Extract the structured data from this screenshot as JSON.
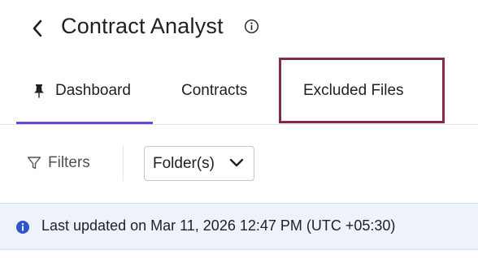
{
  "header": {
    "back_icon": "chevron-left-icon",
    "title": "Contract Analyst",
    "info_icon": "info-circle-icon"
  },
  "tabs": [
    {
      "label": "Dashboard",
      "icon": "pin-icon",
      "active": true
    },
    {
      "label": "Contracts",
      "active": false
    },
    {
      "label": "Excluded Files",
      "active": false,
      "highlighted": true
    }
  ],
  "toolbar": {
    "filters_label": "Filters",
    "filter_icon": "filter-funnel-icon",
    "folder_select_value": "Folder(s)",
    "folder_select_icon": "chevron-down-icon"
  },
  "banner": {
    "icon": "info-filled-icon",
    "text": "Last updated on Mar 11, 2026 12:47 PM (UTC +05:30)"
  },
  "colors": {
    "active_tab_underline": "#6a45d6",
    "highlight_outline": "#852a4a",
    "banner_background": "#eef3fb",
    "info_icon": "#2f55c9"
  }
}
